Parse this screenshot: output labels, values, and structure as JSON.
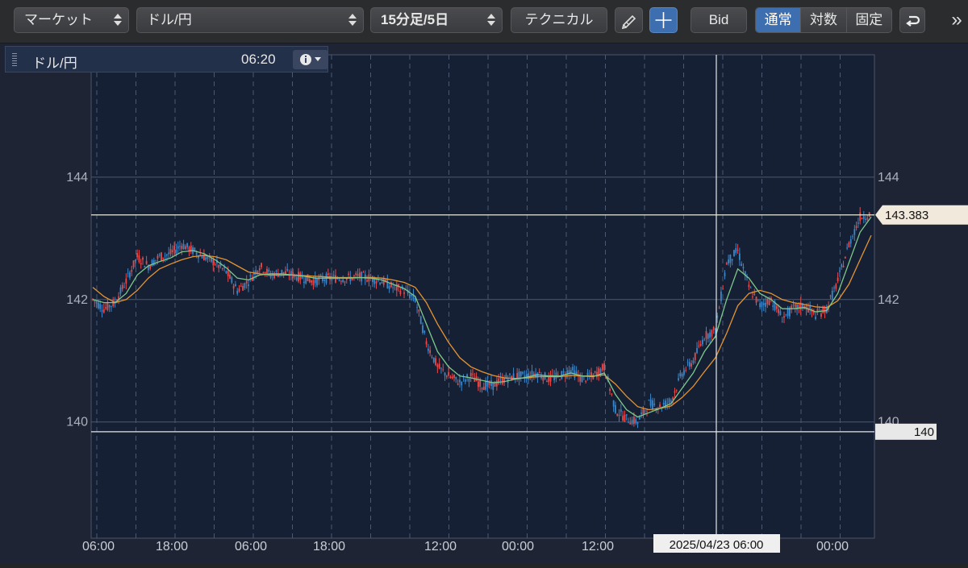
{
  "toolbar": {
    "market_select": "マーケット",
    "symbol_select": "ドル/円",
    "period_select": "15分足/5日",
    "technical_button": "テクニカル",
    "draw_icon": "pencil-icon",
    "crosshair_icon": "crosshair-icon",
    "bid_button": "Bid",
    "scale_modes": [
      "通常",
      "対数",
      "固定"
    ],
    "scale_active": "通常",
    "undo_icon": "undo-icon",
    "more_label": "»"
  },
  "panel": {
    "symbol": "ドル/円",
    "time": "06:20",
    "info_icon": "info-icon"
  },
  "chart_data": {
    "type": "line",
    "title": "",
    "y_axis": {
      "ticks": [
        "144",
        "142",
        "140"
      ],
      "range": [
        138.1,
        146.0
      ]
    },
    "x_axis": {
      "ticks": [
        "06:00",
        "18:00",
        "06:00",
        "18:00",
        "12:00",
        "00:00",
        "12:00",
        "00:00"
      ]
    },
    "last_price_label": "143.383",
    "crosshair": {
      "price_label": "140",
      "time_label": "2025/04/23 06:00",
      "price": 139.84
    },
    "grid": true,
    "price_series": [
      142.0,
      141.85,
      141.95,
      142.3,
      142.7,
      142.55,
      142.7,
      142.75,
      142.9,
      142.8,
      142.7,
      142.6,
      142.45,
      142.15,
      142.3,
      142.55,
      142.4,
      142.45,
      142.4,
      142.35,
      142.3,
      142.35,
      142.35,
      142.35,
      142.38,
      142.35,
      142.3,
      142.2,
      142.15,
      142.0,
      141.3,
      140.9,
      140.75,
      140.65,
      140.75,
      140.6,
      140.6,
      140.7,
      140.75,
      140.75,
      140.8,
      140.7,
      140.75,
      140.85,
      140.7,
      140.75,
      140.9,
      140.2,
      140.05,
      140.0,
      140.3,
      140.25,
      140.35,
      140.8,
      141.0,
      141.4,
      141.5,
      142.6,
      142.8,
      142.2,
      141.9,
      142.0,
      141.7,
      141.85,
      141.9,
      141.75,
      141.85,
      142.3,
      142.9,
      143.35,
      143.4
    ],
    "ma_short": [
      142.0,
      141.95,
      141.95,
      142.1,
      142.4,
      142.55,
      142.62,
      142.68,
      142.78,
      142.8,
      142.75,
      142.65,
      142.52,
      142.35,
      142.32,
      142.4,
      142.42,
      142.42,
      142.4,
      142.38,
      142.35,
      142.35,
      142.35,
      142.35,
      142.36,
      142.35,
      142.32,
      142.25,
      142.18,
      142.05,
      141.6,
      141.15,
      140.9,
      140.75,
      140.72,
      140.68,
      140.64,
      140.66,
      140.7,
      140.73,
      140.77,
      140.75,
      140.75,
      140.8,
      140.75,
      140.74,
      140.8,
      140.45,
      140.2,
      140.08,
      140.15,
      140.22,
      140.3,
      140.55,
      140.8,
      141.15,
      141.4,
      142.0,
      142.5,
      142.35,
      142.1,
      142.0,
      141.85,
      141.85,
      141.87,
      141.8,
      141.82,
      142.1,
      142.6,
      143.1,
      143.35
    ],
    "ma_long": [
      142.2,
      142.05,
      141.95,
      142.0,
      142.15,
      142.35,
      142.5,
      142.58,
      142.65,
      142.7,
      142.72,
      142.7,
      142.65,
      142.55,
      142.45,
      142.42,
      142.4,
      142.4,
      142.4,
      142.39,
      142.38,
      142.37,
      142.36,
      142.36,
      142.36,
      142.36,
      142.35,
      142.32,
      142.28,
      142.2,
      141.95,
      141.6,
      141.3,
      141.05,
      140.9,
      140.82,
      140.76,
      140.72,
      140.71,
      140.72,
      140.74,
      140.74,
      140.74,
      140.76,
      140.75,
      140.75,
      140.77,
      140.62,
      140.42,
      140.25,
      140.2,
      140.22,
      140.26,
      140.4,
      140.58,
      140.82,
      141.05,
      141.45,
      141.9,
      142.1,
      142.15,
      142.1,
      142.0,
      141.95,
      141.92,
      141.88,
      141.87,
      141.98,
      142.25,
      142.65,
      143.05
    ]
  }
}
